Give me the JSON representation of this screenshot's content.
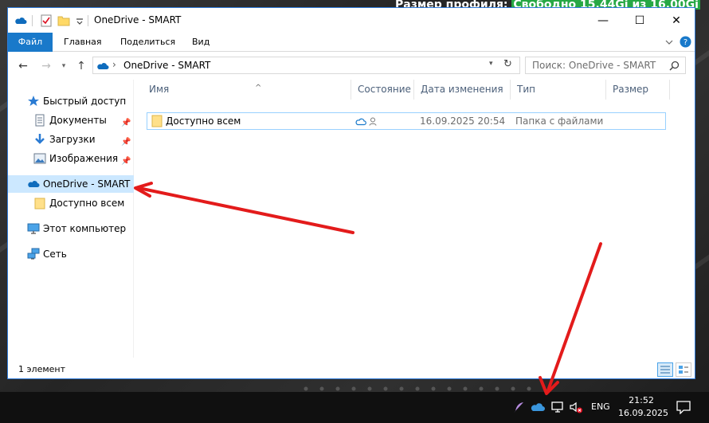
{
  "desktop": {
    "overlay_label": "Размер профиля:",
    "overlay_value": "Свободно 15.44Gi из 16.00Gi"
  },
  "window": {
    "title": "OneDrive - SMART",
    "controls": {
      "minimize": "—",
      "maximize": "☐",
      "close": "✕"
    }
  },
  "ribbon": {
    "tabs": [
      "Файл",
      "Главная",
      "Поделиться",
      "Вид"
    ],
    "expand_icon": "chevron-down-icon",
    "help_icon": "help-icon"
  },
  "address": {
    "path": "OneDrive - SMART",
    "search_placeholder": "Поиск: OneDrive - SMART"
  },
  "nav": {
    "items": [
      {
        "label": "Быстрый доступ",
        "icon": "star-icon"
      },
      {
        "label": "Документы",
        "icon": "documents-icon"
      },
      {
        "label": "Загрузки",
        "icon": "downloads-icon"
      },
      {
        "label": "Изображения",
        "icon": "pictures-icon"
      },
      {
        "label": "OneDrive - SMART",
        "icon": "onedrive-cloud-icon"
      },
      {
        "label": "Доступно всем",
        "icon": "folder-icon"
      },
      {
        "label": "Этот компьютер",
        "icon": "computer-icon"
      },
      {
        "label": "Сеть",
        "icon": "network-icon"
      }
    ]
  },
  "table": {
    "columns": [
      "Имя",
      "Состояние",
      "Дата изменения",
      "Тип",
      "Размер"
    ],
    "rows": [
      {
        "name": "Доступно всем",
        "status": "",
        "modified": "16.09.2025 20:54",
        "type": "Папка с файлами",
        "size": ""
      }
    ]
  },
  "status": {
    "count": "1 элемент"
  },
  "taskbar": {
    "lang": "ENG",
    "time": "21:52",
    "date": "16.09.2025"
  },
  "colors": {
    "accent": "#1979ca",
    "selection": "#cce8ff",
    "arrow": "#e31b1b",
    "onedrive": "#0f6cbd"
  }
}
